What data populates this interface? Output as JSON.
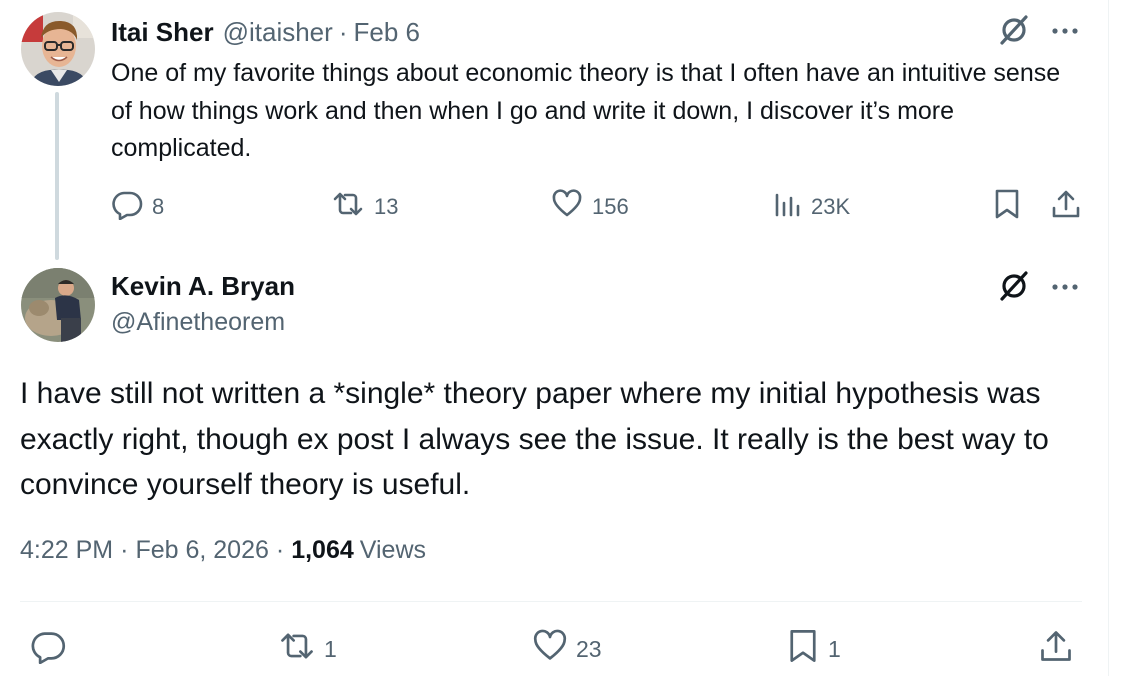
{
  "parent_tweet": {
    "author_name": "Itai Sher",
    "handle": "@itaisher",
    "separator": "·",
    "date": "Feb 6",
    "text": "One of my favorite things about economic theory is that I often have an intuitive sense of how things work and then when I go and write it down, I discover it’s more complicated.",
    "reply_count": "8",
    "retweet_count": "13",
    "like_count": "156",
    "views_count": "23K"
  },
  "main_tweet": {
    "author_name": "Kevin A. Bryan",
    "handle": "@Afinetheorem",
    "text": "I have still not written a *single* theory paper where my initial hypothesis was exactly right, though ex post I always see the issue. It really is the best way to convince yourself theory is useful.",
    "time": "4:22 PM",
    "separator": "·",
    "date": "Feb 6, 2026",
    "views_count": "1,064",
    "views_label": "Views",
    "retweet_count": "1",
    "like_count": "23",
    "bookmark_count": "1"
  },
  "icons": {
    "reply": "reply-icon",
    "retweet": "retweet-icon",
    "like": "heart-icon",
    "views": "views-icon",
    "bookmark": "bookmark-icon",
    "share": "share-icon",
    "grok": "grok-icon",
    "more": "more-icon"
  },
  "colors": {
    "text_primary": "#0f1419",
    "text_secondary": "#536471",
    "thread_line": "#cfd9de",
    "divider": "#eff3f4"
  }
}
